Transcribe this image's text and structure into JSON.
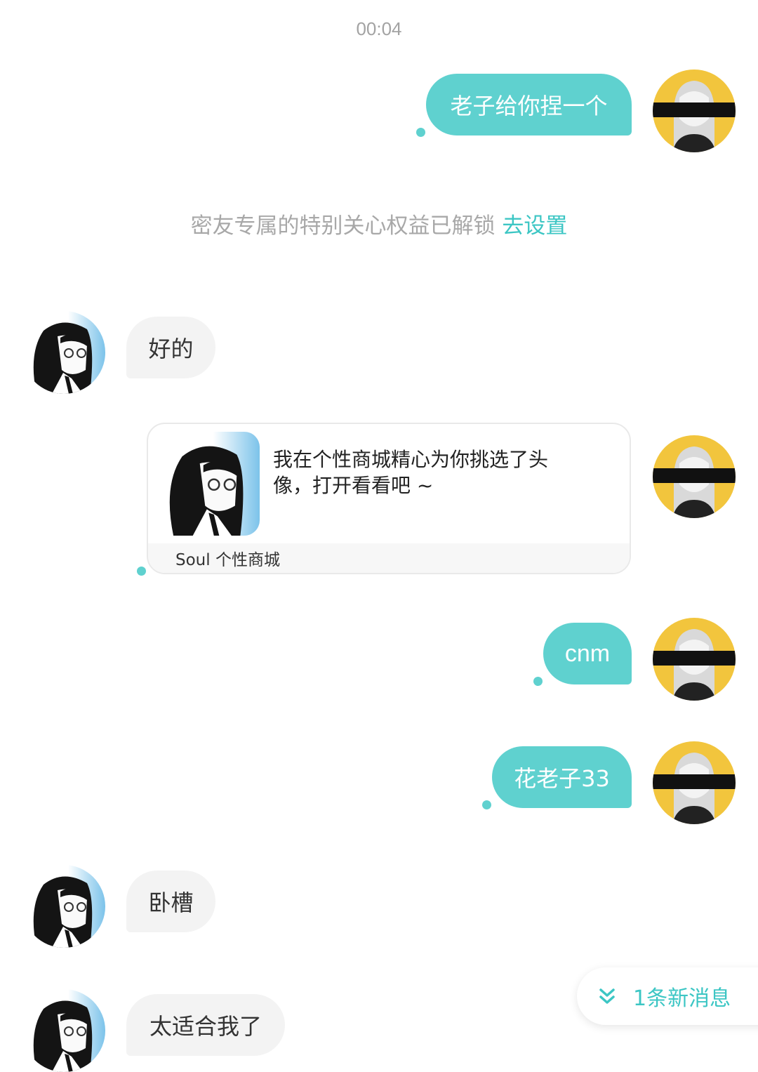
{
  "timestamp": "00:04",
  "system_notice": {
    "text": "密友专属的特别关心权益已解锁",
    "link": "去设置"
  },
  "messages": [
    {
      "direction": "outgoing",
      "text": "老子给你捏一个"
    },
    {
      "direction": "incoming",
      "text": "好的"
    },
    {
      "direction": "outgoing",
      "type": "card",
      "card": {
        "text": "我在个性商城精心为你挑选了头像，打开看看吧～",
        "line1": "我在个性商城精心为你挑选了头",
        "line2": "像，打开看看吧 ~",
        "source": "Soul 个性商城"
      }
    },
    {
      "direction": "outgoing",
      "text": "cnm"
    },
    {
      "direction": "outgoing",
      "text": "花老子33"
    },
    {
      "direction": "incoming",
      "text": "卧槽"
    },
    {
      "direction": "incoming",
      "text": "太适合我了"
    }
  ],
  "new_message_indicator": {
    "icon": "double-chevron-down-icon",
    "text": "1条新消息"
  },
  "colors": {
    "accent": "#5fd1cf",
    "link": "#3cc6c4",
    "incoming_bubble": "#f3f3f3",
    "avatar_self_bg": "#f2c53d",
    "avatar_self_bar": "#111111"
  }
}
